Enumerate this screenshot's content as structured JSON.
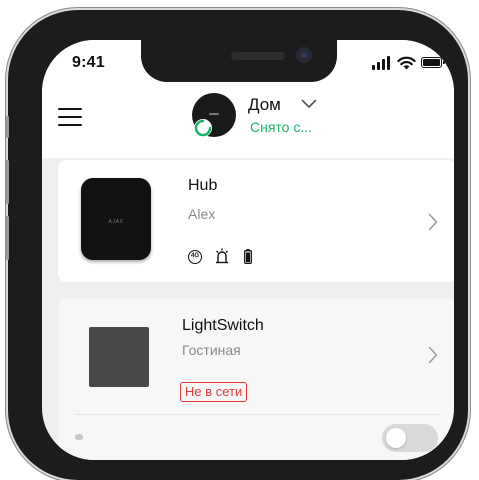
{
  "status_bar": {
    "time": "9:41",
    "icons": [
      "cellular-signal-icon",
      "wifi-icon",
      "battery-icon"
    ]
  },
  "header": {
    "menu_icon": "hamburger-menu-icon",
    "home_name": "Дом",
    "home_status": "Снято с...",
    "status_color": "#19b36b"
  },
  "devices": [
    {
      "name": "Hub",
      "room": "Alex",
      "logo_text": "AJAX",
      "icons": [
        "4g-icon",
        "siren-icon",
        "battery-icon"
      ],
      "chevron": "chevron-right-icon"
    },
    {
      "name": "LightSwitch",
      "room": "Гостиная",
      "badge": "Не в сети",
      "badge_color": "#e03b3b",
      "chevron": "chevron-right-icon",
      "toggle_on": false
    }
  ]
}
